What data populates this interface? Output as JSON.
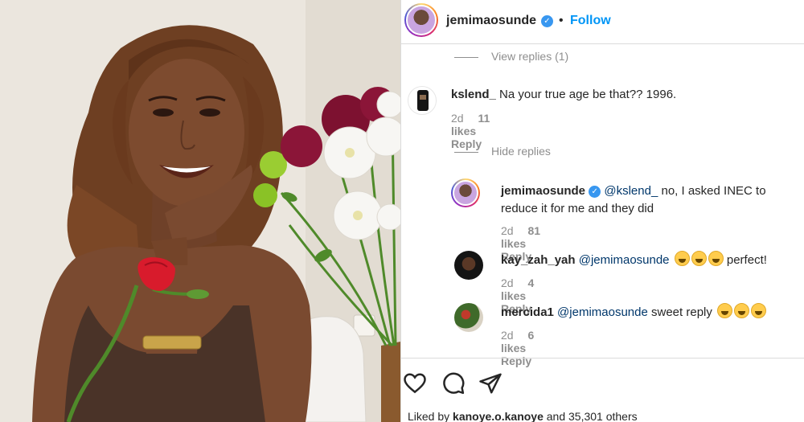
{
  "post": {
    "username": "jemimaosunde",
    "verified": true,
    "dot": "•",
    "follow_label": "Follow"
  },
  "thread": {
    "view_replies": "View replies (1)",
    "hide_replies": "Hide replies"
  },
  "comments": [
    {
      "username": "kslend_",
      "text": "Na your true age be that?? 1996.",
      "age": "2d",
      "likes": "11 likes",
      "reply": "Reply",
      "avatar_color": "#1a1a1a"
    },
    {
      "username": "jemimaosunde",
      "verified": true,
      "mention": "@kslend_",
      "text_line1": "no, I asked INEC to",
      "text_line2": "reduce it for me and they did",
      "age": "2d",
      "likes": "81 likes",
      "reply": "Reply"
    },
    {
      "username": "kay_zah_yah",
      "mention": "@jemimaosunde",
      "text": "perfect!",
      "emoji": "tears-of-joy-emoji",
      "emoji_count": 3,
      "age": "2d",
      "likes": "4 likes",
      "reply": "Reply"
    },
    {
      "username": "mercida1",
      "mention": "@jemimaosunde",
      "text": "sweet reply",
      "emoji": "tears-of-joy-emoji",
      "emoji_count": 3,
      "age": "2d",
      "likes": "6 likes",
      "reply": "Reply"
    }
  ],
  "actions": {
    "like_icon": "heart-icon",
    "comment_icon": "comment-icon",
    "share_icon": "share-icon"
  },
  "liked_by": {
    "prefix": "Liked by",
    "user": "kanoye.o.kanoye",
    "suffix": "and 35,301 others"
  },
  "colors": {
    "link_blue": "#0095f6",
    "verified_blue": "#3897f0",
    "meta_gray": "#8e8e8e",
    "text": "#262626",
    "rose": "#d81b2c",
    "burgundy": "#8b1538",
    "skin": "#7a4a30",
    "dress": "#4a3328"
  }
}
